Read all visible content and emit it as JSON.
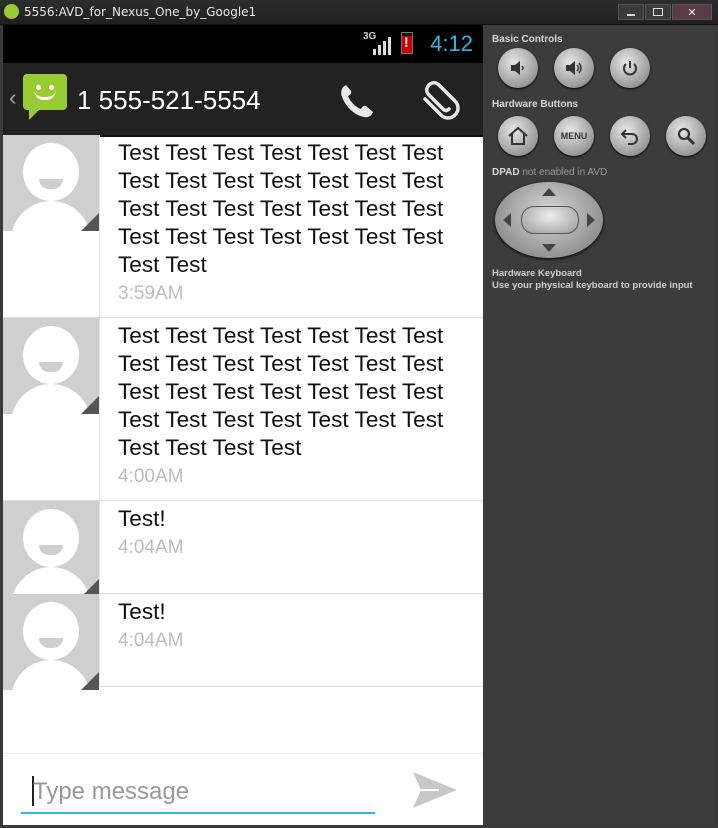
{
  "window": {
    "title": "5556:AVD_for_Nexus_One_by_Google1"
  },
  "status_bar": {
    "network": "3G",
    "time": "4:12"
  },
  "action_bar": {
    "contact": "1 555-521-5554"
  },
  "messages": [
    {
      "text": "Test Test Test Test Test Test Test Test Test Test Test Test Test Test Test Test Test Test Test Test Test Test Test Test Test Test Test Test Test Test",
      "time": "3:59AM"
    },
    {
      "text": "Test Test Test Test Test Test Test Test Test Test Test Test Test Test Test Test Test Test Test Test Test Test Test Test Test Test Test Test Test Test Test Test",
      "time": "4:00AM"
    },
    {
      "text": "Test!",
      "time": "4:04AM"
    },
    {
      "text": "Test!",
      "time": "4:04AM"
    }
  ],
  "composer": {
    "placeholder": "Type message"
  },
  "emulator_panel": {
    "basic_controls": "Basic Controls",
    "hardware_buttons": "Hardware Buttons",
    "menu_label": "MENU",
    "dpad_label": "DPAD",
    "dpad_status": "not enabled in AVD",
    "keyboard_title": "Hardware Keyboard",
    "keyboard_hint": "Use your physical keyboard to provide input"
  },
  "colors": {
    "accent": "#33b5e5",
    "brand_green": "#99cc33",
    "titlebar": "#262626"
  }
}
